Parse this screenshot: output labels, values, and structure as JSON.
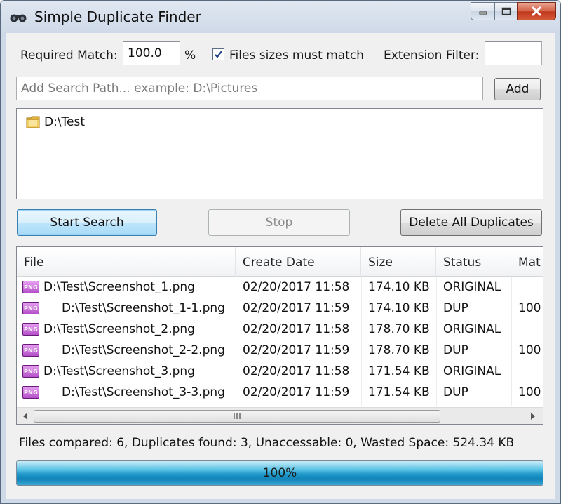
{
  "window": {
    "title": "Simple Duplicate Finder",
    "icons": {
      "app": "binoculars-icon",
      "minimize": "minimize-icon",
      "maximize": "maximize-icon",
      "close": "close-icon"
    }
  },
  "options": {
    "required_match_label": "Required Match:",
    "required_match_value": "100.0",
    "percent_label": "%",
    "sizes_must_match_label": "Files sizes must match",
    "sizes_must_match_checked": true,
    "extension_filter_label": "Extension Filter:",
    "extension_filter_value": ""
  },
  "search_path": {
    "placeholder": "Add Search Path... example: D:\\Pictures",
    "add_label": "Add",
    "paths": [
      "D:\\Test"
    ]
  },
  "actions": {
    "start_label": "Start Search",
    "stop_label": "Stop",
    "delete_label": "Delete All Duplicates"
  },
  "results": {
    "columns": [
      "File",
      "Create Date",
      "Size",
      "Status",
      "Mat"
    ],
    "rows": [
      {
        "file": "D:\\Test\\Screenshot_1.png",
        "date": "02/20/2017  11:58",
        "size": "174.10 KB",
        "status": "ORIGINAL",
        "match": ""
      },
      {
        "file": "D:\\Test\\Screenshot_1-1.png",
        "date": "02/20/2017  11:59",
        "size": "174.10 KB",
        "status": "DUP",
        "match": "100"
      },
      {
        "file": "D:\\Test\\Screenshot_2.png",
        "date": "02/20/2017  11:58",
        "size": "178.70 KB",
        "status": "ORIGINAL",
        "match": ""
      },
      {
        "file": "D:\\Test\\Screenshot_2-2.png",
        "date": "02/20/2017  11:59",
        "size": "178.70 KB",
        "status": "DUP",
        "match": "100"
      },
      {
        "file": "D:\\Test\\Screenshot_3.png",
        "date": "02/20/2017  11:58",
        "size": "171.54 KB",
        "status": "ORIGINAL",
        "match": ""
      },
      {
        "file": "D:\\Test\\Screenshot_3-3.png",
        "date": "02/20/2017  11:59",
        "size": "171.54 KB",
        "status": "DUP",
        "match": "100"
      }
    ],
    "file_icon_label": "PNG",
    "scroll_grip_label": "III"
  },
  "status": {
    "text": "Files compared: 6, Duplicates found: 3, Unaccessable: 0, Wasted Space: 524.34 KB"
  },
  "progress": {
    "fraction": 1.0,
    "label": "100%"
  }
}
